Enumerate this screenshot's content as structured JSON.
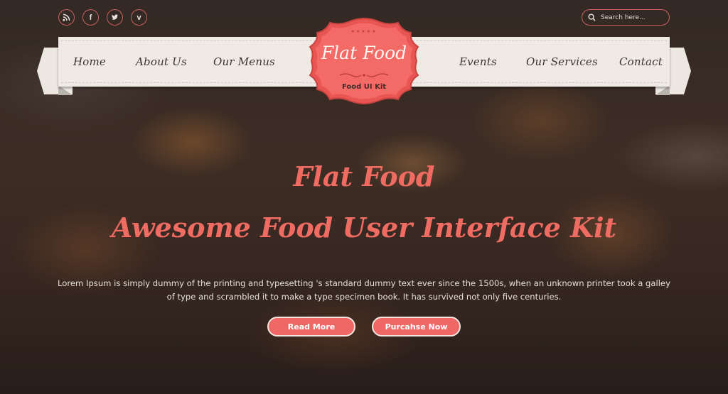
{
  "social": [
    {
      "name": "rss",
      "icon": "rss-icon"
    },
    {
      "name": "facebook",
      "icon": "facebook-icon",
      "glyph": "f"
    },
    {
      "name": "twitter",
      "icon": "twitter-icon"
    },
    {
      "name": "vimeo",
      "icon": "vimeo-icon",
      "glyph": "v"
    }
  ],
  "search": {
    "placeholder": "Search here...",
    "value": ""
  },
  "nav": {
    "left": [
      "Home",
      "About Us",
      "Our Menus"
    ],
    "right": [
      "Events",
      "Our Services",
      "Contact"
    ]
  },
  "logo": {
    "stars": "★★★★★",
    "title": "Flat Food",
    "subtitle": "Food UI Kit"
  },
  "hero": {
    "title": "Flat Food",
    "subtitle": "Awesome Food User Interface Kit",
    "description": "Lorem Ipsum is simply dummy of the printing and typesetting 's standard dummy text ever since the 1500s, when an unknown printer took a galley of type and scrambled it to make a type specimen book. It has survived not only five centuries.",
    "buttons": {
      "read_more": "Read More",
      "purchase": "Purcahse Now"
    }
  },
  "colors": {
    "accent": "#f06866",
    "ribbon": "#efebe4",
    "nav_text": "#3a3432"
  }
}
